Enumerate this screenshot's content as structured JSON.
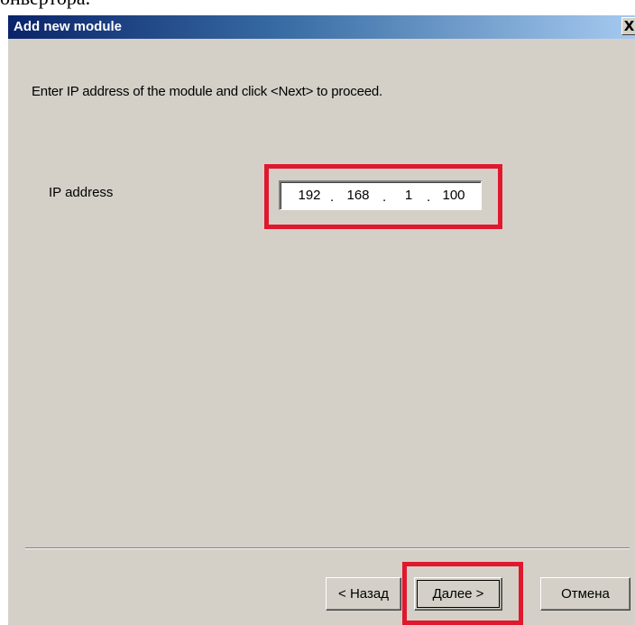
{
  "page": {
    "top_text_fragment": "онвертора."
  },
  "dialog": {
    "title": "Add new module",
    "close_glyph": "X",
    "instruction": "Enter IP address of the module and click <Next> to proceed.",
    "ip_label": "IP address",
    "ip_octets": [
      "192",
      "168",
      "1",
      "100"
    ],
    "ip_dot": "."
  },
  "buttons": {
    "back_label": "< Назад",
    "next_label": "Далее >",
    "cancel_label": "Отмена"
  },
  "colors": {
    "highlight": "#e0182e",
    "titlebar_start": "#0a246a",
    "titlebar_end": "#a6caf0",
    "dialog_bg": "#d4d0c8"
  },
  "icons": {
    "close": "close-icon"
  }
}
